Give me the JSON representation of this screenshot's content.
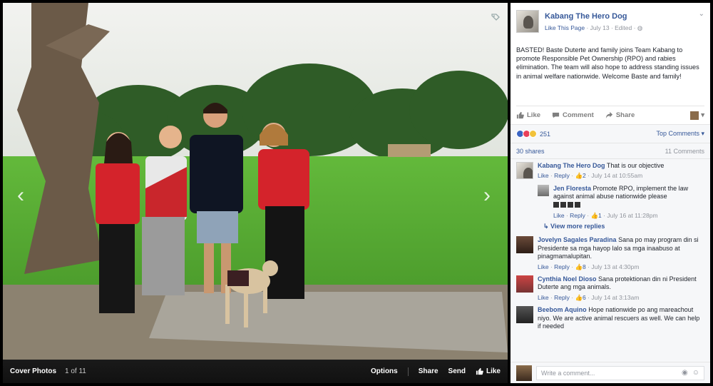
{
  "photo_bar": {
    "album": "Cover Photos",
    "count": "1 of 11",
    "options": "Options",
    "share": "Share",
    "send": "Send",
    "like": "Like"
  },
  "post": {
    "page_name": "Kabang The Hero Dog",
    "like_page": "Like This Page",
    "date": "July 13",
    "edited": "Edited",
    "text": "BASTED! Baste Duterte and family joins Team Kabang to promote Responsible Pet Ownership (RPO) and rabies elimination. The team will also hope to address standing issues in animal welfare nationwide. Welcome Baste and family!",
    "actions": {
      "like": "Like",
      "comment": "Comment",
      "share": "Share"
    },
    "reaction_count": "251",
    "top_comments": "Top Comments",
    "shares": "30 shares",
    "comments_count": "11 Comments"
  },
  "comments": [
    {
      "name": "Kabang The Hero Dog",
      "text": "That is our objective",
      "like": "Like",
      "reply": "Reply",
      "likes": "2",
      "time": "July 14 at 10:55am"
    },
    {
      "name": "Jen Floresta",
      "text": "Promote RPO, implement the law against animal abuse nationwide please",
      "like": "Like",
      "reply": "Reply",
      "likes": "1",
      "time": "July 16 at 11:28pm"
    },
    {
      "name": "Jovelyn Sagales Paradina",
      "text": "Sana po may program din si Presidente sa mga hayop lalo sa mga inaabuso at pinagmamalupitan.",
      "like": "Like",
      "reply": "Reply",
      "likes": "8",
      "time": "July 13 at 4:30pm"
    },
    {
      "name": "Cynthia Noel Dioso",
      "text": "Sana protektionan din ni President Duterte ang mga animals.",
      "like": "Like",
      "reply": "Reply",
      "likes": "6",
      "time": "July 14 at 3:13am"
    },
    {
      "name": "Beebom Aquino",
      "text": "Hope nationwide po ang mareachout niyo. We are active animal rescuers as well. We can help if needed"
    }
  ],
  "view_more": "View more replies",
  "write_placeholder": "Write a comment...",
  "colors": {
    "link": "#365899",
    "panel_bg": "#f6f7f9",
    "photo_bar": "#111111"
  }
}
